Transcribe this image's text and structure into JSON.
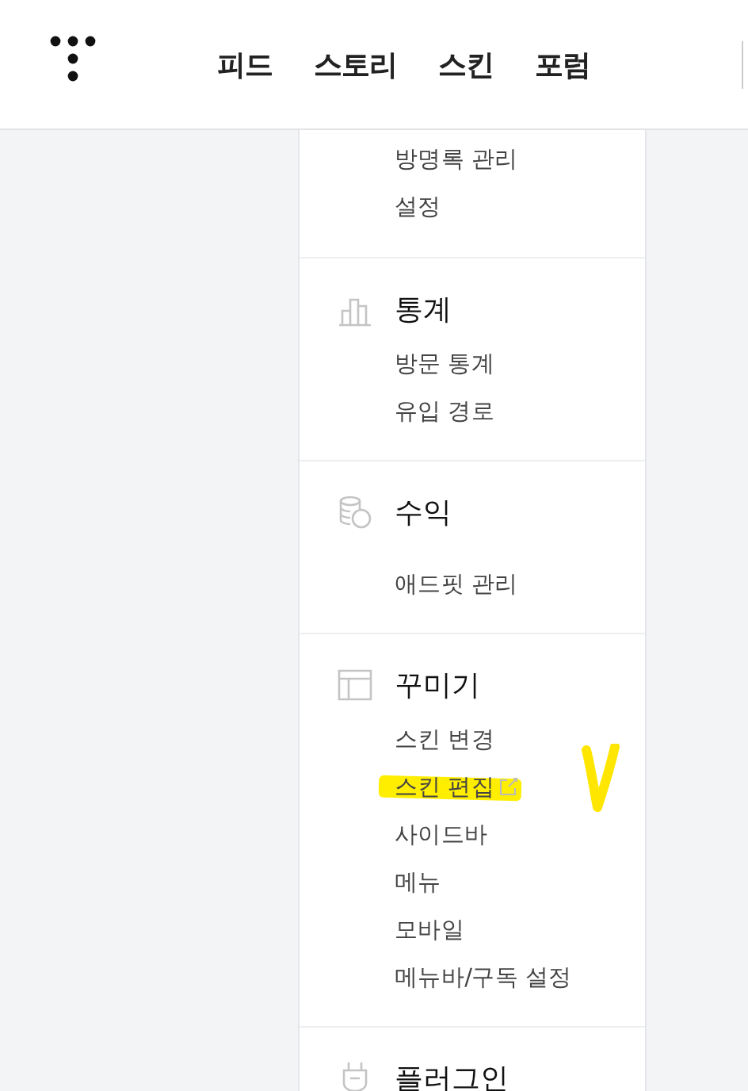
{
  "header": {
    "nav": [
      {
        "label": "피드"
      },
      {
        "label": "스토리"
      },
      {
        "label": "스킨"
      },
      {
        "label": "포럼"
      }
    ]
  },
  "sections": [
    {
      "kind": "none",
      "items": [
        {
          "label": "방명록 관리",
          "external": false,
          "highlighted": false
        },
        {
          "label": "설정",
          "external": false,
          "highlighted": false
        }
      ]
    },
    {
      "kind": "chart",
      "title": "통계",
      "items": [
        {
          "label": "방문 통계",
          "external": false,
          "highlighted": false
        },
        {
          "label": "유입 경로",
          "external": false,
          "highlighted": false
        }
      ]
    },
    {
      "kind": "coins",
      "title": "수익",
      "items": [
        {
          "label": "애드핏 관리",
          "external": false,
          "highlighted": false
        }
      ]
    },
    {
      "kind": "layout",
      "title": "꾸미기",
      "items": [
        {
          "label": "스킨 변경",
          "external": false,
          "highlighted": false
        },
        {
          "label": "스킨 편집",
          "external": true,
          "highlighted": true
        },
        {
          "label": "사이드바",
          "external": false,
          "highlighted": false
        },
        {
          "label": "메뉴",
          "external": false,
          "highlighted": false
        },
        {
          "label": "모바일",
          "external": false,
          "highlighted": false
        },
        {
          "label": "메뉴바/구독 설정",
          "external": false,
          "highlighted": false
        }
      ]
    },
    {
      "kind": "plug",
      "title": "플러그인"
    }
  ]
}
